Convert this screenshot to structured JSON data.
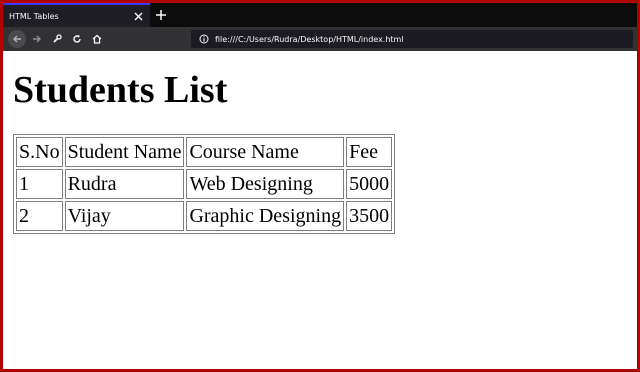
{
  "browser": {
    "tab_title": "HTML Tables",
    "url": "file:///C:/Users/Rudra/Desktop/HTML/index.html"
  },
  "page": {
    "heading": "Students List",
    "table": {
      "headers": [
        "S.No",
        "Student Name",
        "Course Name",
        "Fee"
      ],
      "rows": [
        [
          "1",
          "Rudra",
          "Web Designing",
          "5000"
        ],
        [
          "2",
          "Vijay",
          "Graphic Designing",
          "3500"
        ]
      ]
    }
  },
  "icons": {
    "close": "close-icon",
    "new_tab": "plus-icon",
    "back": "back-arrow-icon",
    "forward": "forward-arrow-icon",
    "tools": "wrench-icon",
    "reload": "reload-icon",
    "home": "home-icon",
    "info": "info-icon"
  },
  "colors": {
    "frame_border": "#b00000",
    "tabbar_bg": "#0c0c0d",
    "toolbar_bg": "#323234",
    "urlbar_bg": "#1c1b22"
  }
}
